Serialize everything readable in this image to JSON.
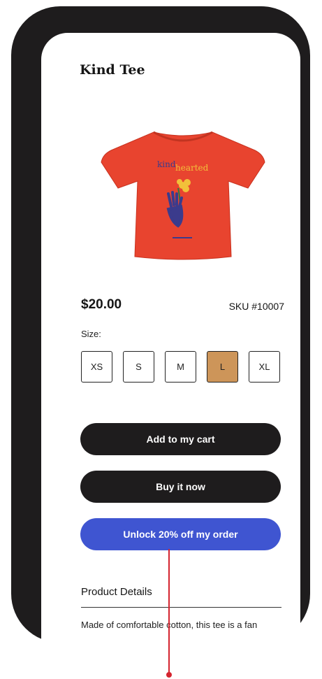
{
  "product": {
    "title": "Kind Tee",
    "image_alt": "Red t-shirt with \"kind hearted\" print",
    "shirt_text_1": "kind",
    "shirt_text_2": "hearted",
    "price": "$20.00",
    "sku": "SKU #10007"
  },
  "size_selector": {
    "label": "Size:",
    "options": [
      "XS",
      "S",
      "M",
      "L",
      "XL"
    ],
    "selected": "L"
  },
  "actions": {
    "add_to_cart": "Add to my cart",
    "buy_now": "Buy it now",
    "unlock_discount": "Unlock 20% off my order"
  },
  "details": {
    "heading": "Product Details",
    "text": "Made of comfortable cotton, this tee is a fan"
  },
  "colors": {
    "frame": "#1e1c1d",
    "primary_button": "#1e1c1d",
    "accent_button": "#3f55d1",
    "selected_size": "#cd9559",
    "annotation": "#d5242f",
    "shirt": "#e8442f"
  }
}
